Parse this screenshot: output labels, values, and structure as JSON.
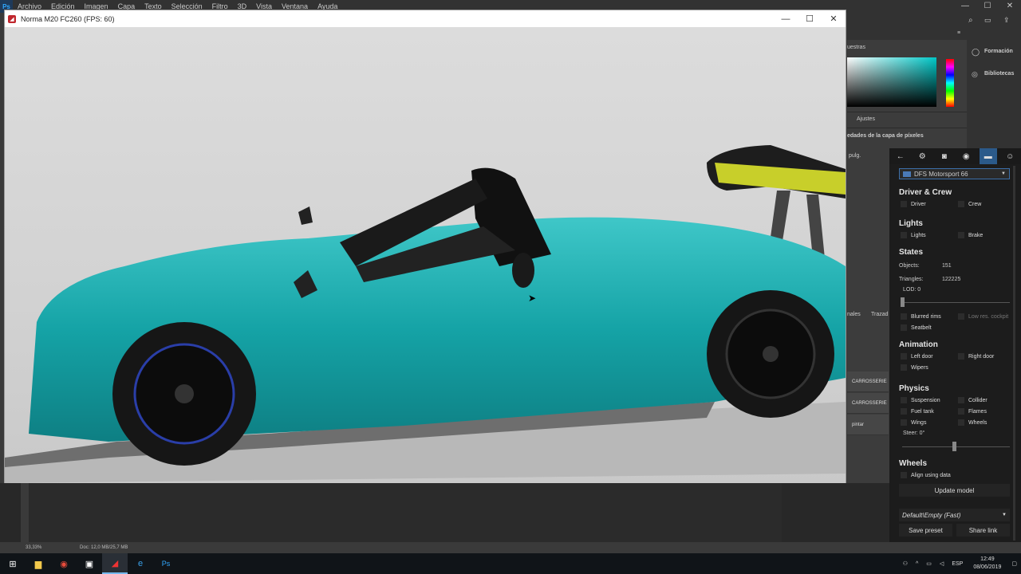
{
  "ps": {
    "logo": "Ps",
    "menu": [
      "Archivo",
      "Edición",
      "Imagen",
      "Capa",
      "Texto",
      "Selección",
      "Filtro",
      "3D",
      "Vista",
      "Ventana",
      "Ayuda"
    ],
    "panel_tab_muestras": "uestras",
    "panel_ajustes": "Ajustes",
    "panel_props": "edades de la capa de píxeles",
    "formacion": "Formación",
    "bibliotecas": "Bibliotecas",
    "option_pulg": "pulg.",
    "tab_canales": "nales",
    "tab_trazados": "Trazad",
    "layers": [
      "CARROSSERIE",
      "CARROSSERIE",
      "pintar"
    ],
    "status_zoom": "33,33%",
    "status_doc": "Doc: 12,0 MB/25,7 MB"
  },
  "app": {
    "title": "Norma M20 FC260 (FPS: 60)",
    "minimize": "—",
    "maximize": "☐",
    "close": "✕"
  },
  "panel": {
    "car": "DFS Motorsport 66",
    "driver_crew": {
      "title": "Driver & Crew",
      "driver": "Driver",
      "crew": "Crew"
    },
    "lights": {
      "title": "Lights",
      "lights": "Lights",
      "brake": "Brake"
    },
    "states": {
      "title": "States",
      "objects_label": "Objects:",
      "objects_value": "151",
      "triangles_label": "Triangles:",
      "triangles_value": "122225",
      "lod": "LOD: 0",
      "blurred_rims": "Blurred rims",
      "low_res_cockpit": "Low res. cockpit",
      "seatbelt": "Seatbelt"
    },
    "animation": {
      "title": "Animation",
      "left_door": "Left door",
      "right_door": "Right door",
      "wipers": "Wipers"
    },
    "physics": {
      "title": "Physics",
      "suspension": "Suspension",
      "collider": "Collider",
      "fuel_tank": "Fuel tank",
      "flames": "Flames",
      "wings": "Wings",
      "wheels": "Wheels",
      "steer": "Steer: 0°"
    },
    "wheels": {
      "title": "Wheels",
      "align": "Align using data"
    },
    "update_model": "Update model",
    "preset": "Default\\Empty (Fast)",
    "save_preset": "Save preset",
    "share_link": "Share link"
  },
  "taskbar": {
    "lang": "ESP",
    "time": "12:49",
    "date": "08/06/2019"
  },
  "colors": {
    "body": "#15a3a6",
    "accent": "#2b5a8a",
    "wing": "#c8cf2a"
  }
}
